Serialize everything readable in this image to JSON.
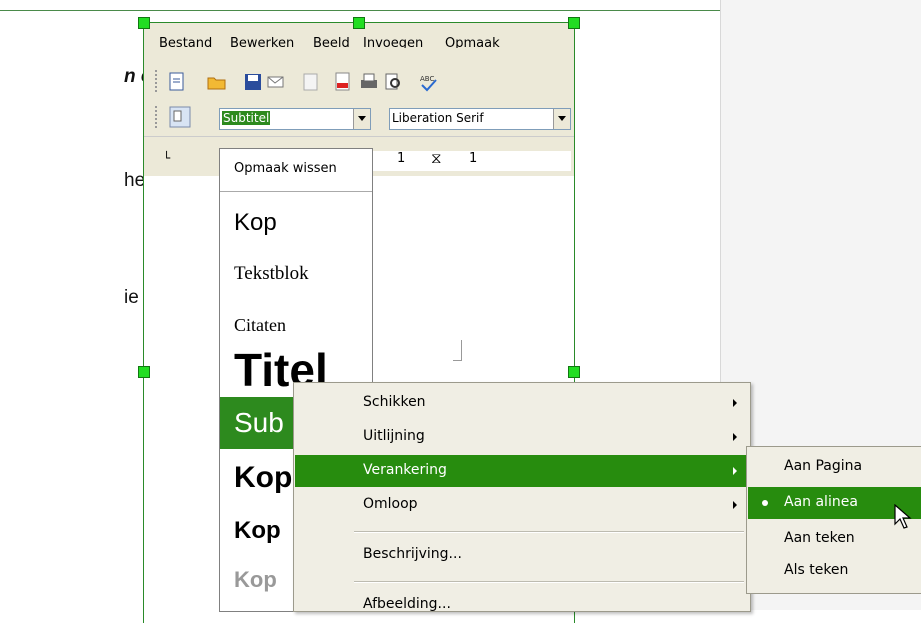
{
  "document": {
    "line1": "n en",
    "line2": "het",
    "line3": "ie zetten."
  },
  "menubar": [
    "Bestand",
    "Bewerken",
    "Beeld",
    "Invoegen",
    "Opmaak"
  ],
  "toolbar": {
    "style_value": "Subtitel",
    "font_value": "Liberation Serif"
  },
  "style_list": {
    "items": [
      "Opmaak wissen",
      "Kop",
      "Tekstblok",
      "Citaten",
      "Titel",
      "Sub",
      "Kop",
      "Kop",
      "Kop"
    ]
  },
  "context_menu": {
    "items": [
      "Schikken",
      "Uitlijning",
      "Verankering",
      "Omloop",
      "Beschrijving...",
      "Afbeelding..."
    ]
  },
  "submenu": {
    "items": [
      "Aan Pagina",
      "Aan alinea",
      "Aan teken",
      "Als teken"
    ]
  },
  "colors": {
    "highlight": "#278c0e",
    "handle": "#22dd22"
  }
}
